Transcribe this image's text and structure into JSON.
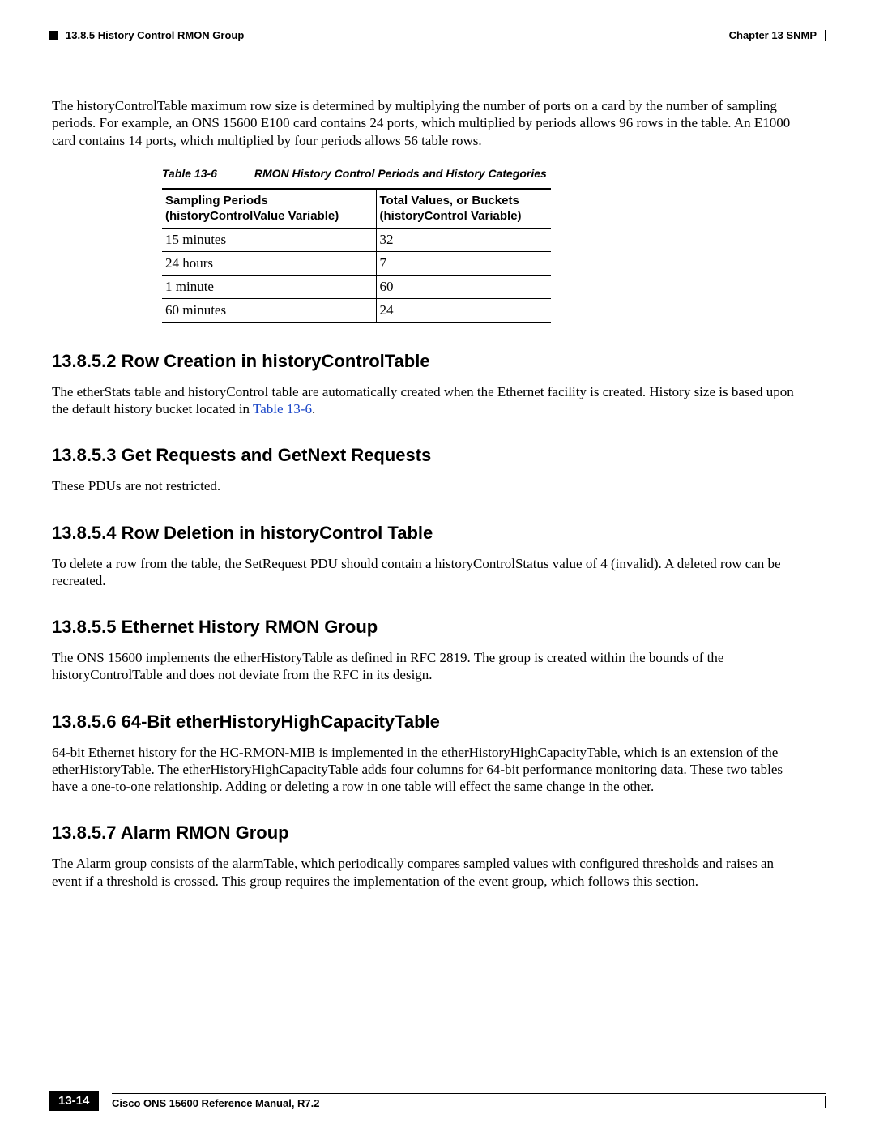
{
  "header": {
    "left": "13.8.5  History Control RMON Group",
    "right": "Chapter 13 SNMP"
  },
  "intro_para": "The historyControlTable maximum row size is determined by multiplying the number of ports on a card by the number of sampling periods. For example, an ONS 15600 E100 card contains 24 ports, which multiplied by periods allows 96 rows in the table. An E1000 card contains 14 ports, which multiplied by four periods allows 56 table rows.",
  "table": {
    "caption_num": "Table 13-6",
    "caption_title": "RMON History Control Periods and History Categories",
    "head_col1_line1": "Sampling Periods",
    "head_col1_line2": "(historyControlValue Variable)",
    "head_col2_line1": "Total Values, or Buckets",
    "head_col2_line2": "(historyControl Variable)",
    "rows": [
      {
        "c1": "15 minutes",
        "c2": "32"
      },
      {
        "c1": "24 hours",
        "c2": "7"
      },
      {
        "c1": "1 minute",
        "c2": "60"
      },
      {
        "c1": "60 minutes",
        "c2": "24"
      }
    ]
  },
  "sections": {
    "s2": {
      "heading": "13.8.5.2  Row Creation in historyControlTable",
      "para_pre": "The etherStats table and historyControl table are automatically created when the Ethernet facility is created. History size is based upon the default history bucket located in ",
      "link_text": "Table 13-6",
      "para_post": "."
    },
    "s3": {
      "heading": "13.8.5.3  Get Requests and GetNext Requests",
      "para": "These PDUs are not restricted."
    },
    "s4": {
      "heading": "13.8.5.4  Row Deletion in historyControl Table",
      "para": "To delete a row from the table, the SetRequest PDU should contain a historyControlStatus value of 4 (invalid). A deleted row can be recreated."
    },
    "s5": {
      "heading": "13.8.5.5  Ethernet History RMON Group",
      "para": "The ONS 15600 implements the etherHistoryTable as defined in RFC 2819. The group is created within the bounds of the historyControlTable and does not deviate from the RFC in its design."
    },
    "s6": {
      "heading": "13.8.5.6  64-Bit etherHistoryHighCapacityTable",
      "para": "64-bit Ethernet history for the HC-RMON-MIB is implemented in the etherHistoryHighCapacityTable, which is an extension of the etherHistoryTable. The etherHistoryHighCapacityTable adds four columns for 64-bit performance monitoring data. These two tables have a one-to-one relationship. Adding or deleting a row in one table will effect the same change in the other."
    },
    "s7": {
      "heading": "13.8.5.7  Alarm RMON Group",
      "para": "The Alarm group consists of the alarmTable, which periodically compares sampled values with configured thresholds and raises an event if a threshold is crossed. This group requires the implementation of the event group, which follows this section."
    }
  },
  "footer": {
    "manual": "Cisco ONS 15600 Reference Manual, R7.2",
    "page": "13-14"
  }
}
